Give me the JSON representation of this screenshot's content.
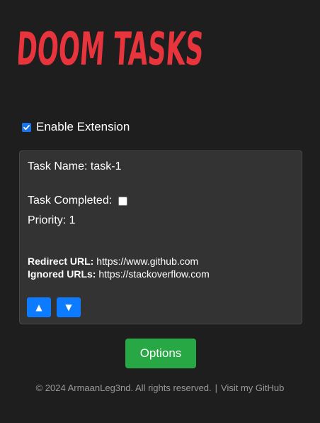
{
  "header": {
    "logo_text": "DOOM TASKS"
  },
  "settings": {
    "enable_label": "Enable Extension",
    "enabled": true
  },
  "task": {
    "name_text": "Task Name: task-1",
    "completed_label": "Task Completed:",
    "completed": false,
    "priority_text": "Priority: 1",
    "redirect_label": "Redirect URL:",
    "redirect_value": "https://www.github.com",
    "ignored_label": "Ignored URLs:",
    "ignored_value": "https://stackoverflow.com",
    "move_up_label": "▲",
    "move_down_label": "▼"
  },
  "actions": {
    "options_label": "Options"
  },
  "footer": {
    "copyright": "© 2024 ArmaanLeg3nd. All rights reserved.",
    "separator": "|",
    "github_link": "Visit my GitHub"
  },
  "colors": {
    "background": "#1e1e1e",
    "logo_red": "#e8343c",
    "card": "#333333",
    "primary_blue": "#0d7bff",
    "options_green": "#28a745"
  }
}
